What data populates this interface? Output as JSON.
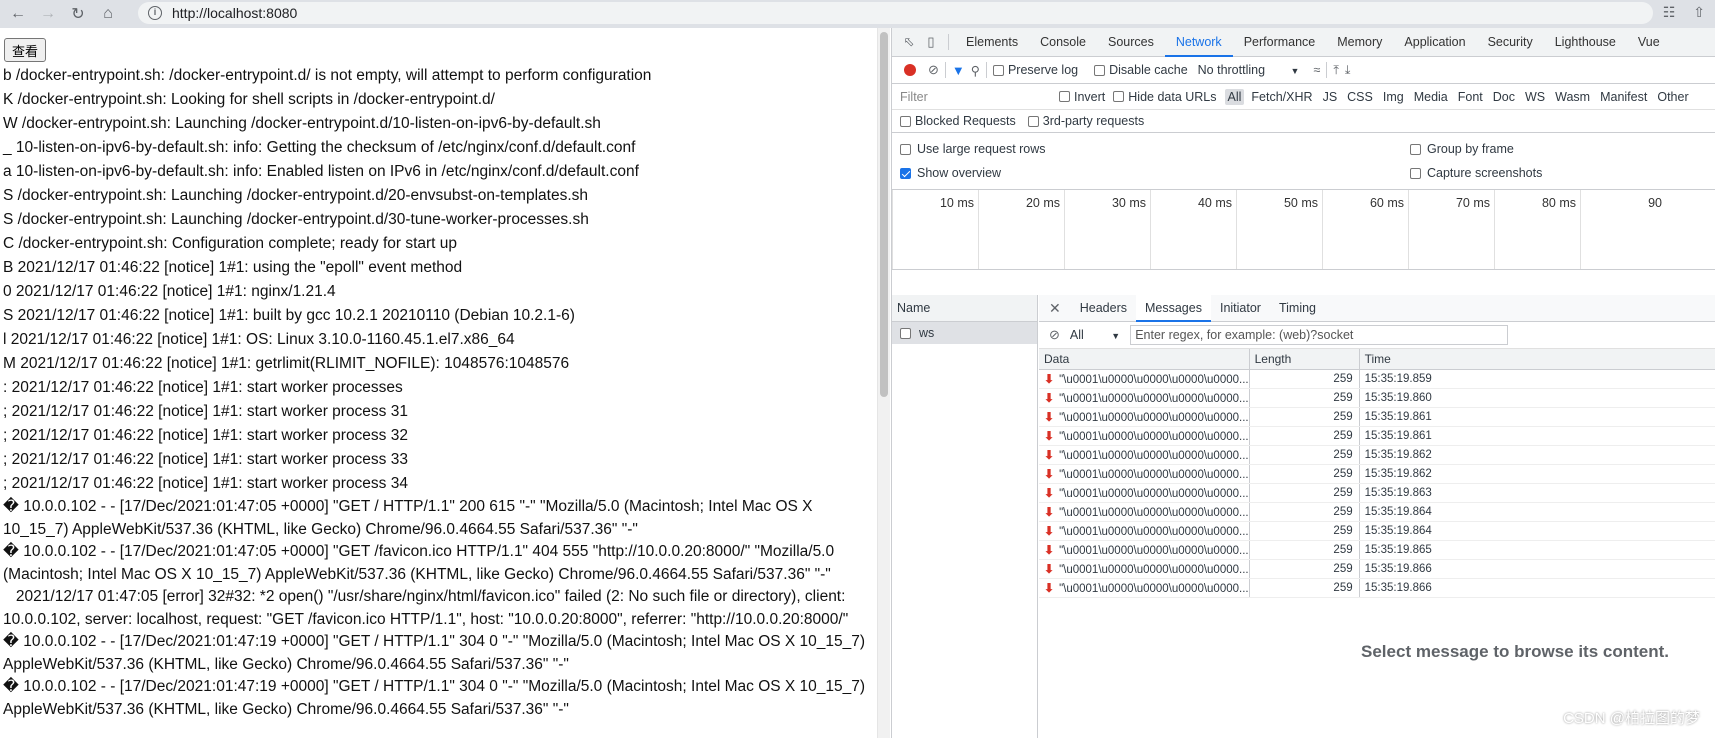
{
  "browser": {
    "url": "http://localhost:8080"
  },
  "page": {
    "button_label": "查看",
    "log_lines": [
      "b /docker-entrypoint.sh: /docker-entrypoint.d/ is not empty, will attempt to perform configuration",
      "K /docker-entrypoint.sh: Looking for shell scripts in /docker-entrypoint.d/",
      "W /docker-entrypoint.sh: Launching /docker-entrypoint.d/10-listen-on-ipv6-by-default.sh",
      "_ 10-listen-on-ipv6-by-default.sh: info: Getting the checksum of /etc/nginx/conf.d/default.conf",
      "a 10-listen-on-ipv6-by-default.sh: info: Enabled listen on IPv6 in /etc/nginx/conf.d/default.conf",
      "S /docker-entrypoint.sh: Launching /docker-entrypoint.d/20-envsubst-on-templates.sh",
      "S /docker-entrypoint.sh: Launching /docker-entrypoint.d/30-tune-worker-processes.sh",
      "C /docker-entrypoint.sh: Configuration complete; ready for start up",
      "B 2021/12/17 01:46:22 [notice] 1#1: using the \"epoll\" event method",
      "0 2021/12/17 01:46:22 [notice] 1#1: nginx/1.21.4",
      "S 2021/12/17 01:46:22 [notice] 1#1: built by gcc 10.2.1 20210110 (Debian 10.2.1-6)",
      "l 2021/12/17 01:46:22 [notice] 1#1: OS: Linux 3.10.0-1160.45.1.el7.x86_64",
      "M 2021/12/17 01:46:22 [notice] 1#1: getrlimit(RLIMIT_NOFILE): 1048576:1048576",
      ": 2021/12/17 01:46:22 [notice] 1#1: start worker processes",
      "; 2021/12/17 01:46:22 [notice] 1#1: start worker process 31",
      "; 2021/12/17 01:46:22 [notice] 1#1: start worker process 32",
      "; 2021/12/17 01:46:22 [notice] 1#1: start worker process 33",
      "; 2021/12/17 01:46:22 [notice] 1#1: start worker process 34"
    ],
    "wrapped_lines": [
      "� 10.0.0.102 - - [17/Dec/2021:01:47:05 +0000] \"GET / HTTP/1.1\" 200 615 \"-\" \"Mozilla/5.0 (Macintosh; Intel Mac OS X 10_15_7) AppleWebKit/537.36 (KHTML, like Gecko) Chrome/96.0.4664.55 Safari/537.36\" \"-\"",
      "� 10.0.0.102 - - [17/Dec/2021:01:47:05 +0000] \"GET /favicon.ico HTTP/1.1\" 404 555 \"http://10.0.0.20:8000/\" \"Mozilla/5.0 (Macintosh; Intel Mac OS X 10_15_7) AppleWebKit/537.36 (KHTML, like Gecko) Chrome/96.0.4664.55 Safari/537.36\" \"-\"",
      "   2021/12/17 01:47:05 [error] 32#32: *2 open() \"/usr/share/nginx/html/favicon.ico\" failed (2: No such file or directory), client: 10.0.0.102, server: localhost, request: \"GET /favicon.ico HTTP/1.1\", host: \"10.0.0.20:8000\", referrer: \"http://10.0.0.20:8000/\"",
      "� 10.0.0.102 - - [17/Dec/2021:01:47:19 +0000] \"GET / HTTP/1.1\" 304 0 \"-\" \"Mozilla/5.0 (Macintosh; Intel Mac OS X 10_15_7) AppleWebKit/537.36 (KHTML, like Gecko) Chrome/96.0.4664.55 Safari/537.36\" \"-\"",
      "� 10.0.0.102 - - [17/Dec/2021:01:47:19 +0000] \"GET / HTTP/1.1\" 304 0 \"-\" \"Mozilla/5.0 (Macintosh; Intel Mac OS X 10_15_7) AppleWebKit/537.36 (KHTML, like Gecko) Chrome/96.0.4664.55 Safari/537.36\" \"-\""
    ]
  },
  "devtools": {
    "tabs": [
      "Elements",
      "Console",
      "Sources",
      "Network",
      "Performance",
      "Memory",
      "Application",
      "Security",
      "Lighthouse",
      "Vue"
    ],
    "active_tab": "Network",
    "toolbar": {
      "preserve_log": "Preserve log",
      "disable_cache": "Disable cache",
      "throttling": "No throttling"
    },
    "filter": {
      "placeholder": "Filter",
      "invert": "Invert",
      "hide_data_urls": "Hide data URLs",
      "types": [
        "All",
        "Fetch/XHR",
        "JS",
        "CSS",
        "Img",
        "Media",
        "Font",
        "Doc",
        "WS",
        "Wasm",
        "Manifest",
        "Other"
      ],
      "blocked_requests": "Blocked Requests",
      "third_party": "3rd-party requests"
    },
    "settings": {
      "large_rows": "Use large request rows",
      "group_by_frame": "Group by frame",
      "show_overview": "Show overview",
      "capture_screenshots": "Capture screenshots"
    },
    "overview_ticks": [
      "10 ms",
      "20 ms",
      "30 ms",
      "40 ms",
      "50 ms",
      "60 ms",
      "70 ms",
      "80 ms",
      "90"
    ],
    "name_header": "Name",
    "request_name": "ws",
    "detail_tabs": [
      "Headers",
      "Messages",
      "Initiator",
      "Timing"
    ],
    "active_detail_tab": "Messages",
    "message_filter": {
      "type": "All",
      "placeholder": "Enter regex, for example: (web)?socket"
    },
    "messages_table": {
      "headers": [
        "Data",
        "Length",
        "Time"
      ],
      "rows": [
        {
          "data": "\"\\u0001\\u0000\\u0000\\u0000\\u0000...",
          "length": "259",
          "time": "15:35:19.859"
        },
        {
          "data": "\"\\u0001\\u0000\\u0000\\u0000\\u0000...",
          "length": "259",
          "time": "15:35:19.860"
        },
        {
          "data": "\"\\u0001\\u0000\\u0000\\u0000\\u0000...",
          "length": "259",
          "time": "15:35:19.861"
        },
        {
          "data": "\"\\u0001\\u0000\\u0000\\u0000\\u0000...",
          "length": "259",
          "time": "15:35:19.861"
        },
        {
          "data": "\"\\u0001\\u0000\\u0000\\u0000\\u0000...",
          "length": "259",
          "time": "15:35:19.862"
        },
        {
          "data": "\"\\u0001\\u0000\\u0000\\u0000\\u0000...",
          "length": "259",
          "time": "15:35:19.862"
        },
        {
          "data": "\"\\u0001\\u0000\\u0000\\u0000\\u0000...",
          "length": "259",
          "time": "15:35:19.863"
        },
        {
          "data": "\"\\u0001\\u0000\\u0000\\u0000\\u0000...",
          "length": "259",
          "time": "15:35:19.864"
        },
        {
          "data": "\"\\u0001\\u0000\\u0000\\u0000\\u0000...",
          "length": "259",
          "time": "15:35:19.864"
        },
        {
          "data": "\"\\u0001\\u0000\\u0000\\u0000\\u0000...",
          "length": "259",
          "time": "15:35:19.865"
        },
        {
          "data": "\"\\u0001\\u0000\\u0000\\u0000\\u0000...",
          "length": "259",
          "time": "15:35:19.866"
        },
        {
          "data": "\"\\u0001\\u0000\\u0000\\u0000\\u0000...",
          "length": "259",
          "time": "15:35:19.866"
        }
      ]
    },
    "empty_message": "Select message to browse its content."
  },
  "watermark": "CSDN @柏拉图的梦"
}
